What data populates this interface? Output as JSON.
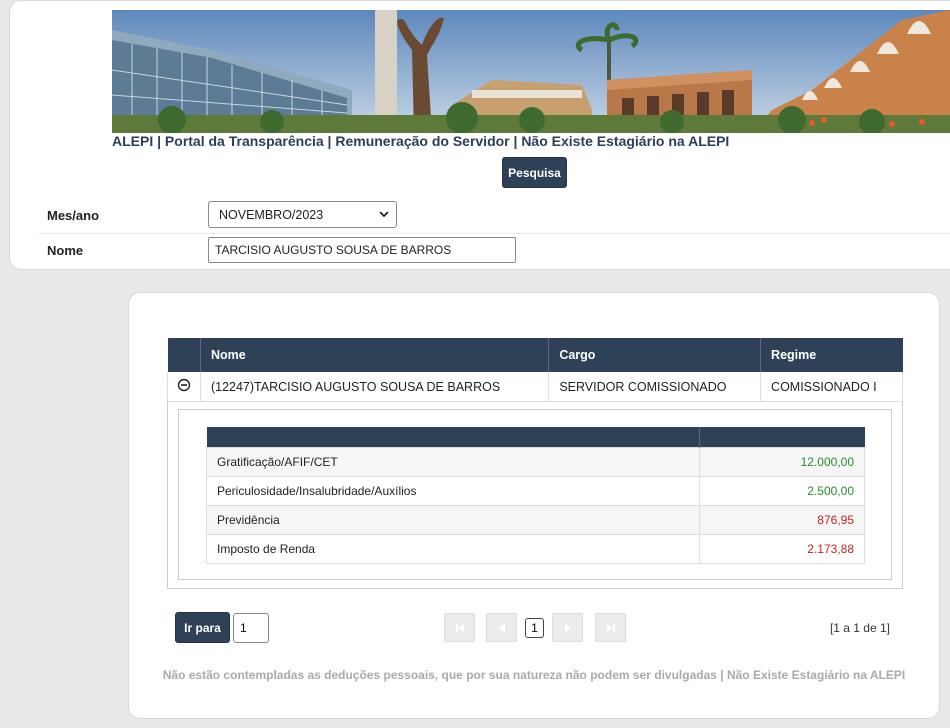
{
  "header": {
    "title": "ALEPI | Portal da Transparência | Remuneração do Servidor | Não Existe Estagiário na ALEPI",
    "search_label": "Pesquisa"
  },
  "form": {
    "month_label": "Mes/ano",
    "month_value": "NOVEMBRO/2023",
    "name_label": "Nome",
    "name_value": "TARCISIO AUGUSTO SOUSA DE BARROS"
  },
  "table": {
    "columns": [
      "Nome",
      "Cargo",
      "Regime"
    ],
    "row": {
      "nome": "(12247)TARCISIO AUGUSTO SOUSA DE BARROS",
      "cargo": "SERVIDOR COMISSIONADO",
      "regime": "COMISSIONADO I"
    }
  },
  "details": [
    {
      "label": "Gratificação/AFIF/CET",
      "value": "12.000,00",
      "kind": "credit"
    },
    {
      "label": "Periculosidade/Insalubridade/Auxílios",
      "value": "2.500,00",
      "kind": "credit"
    },
    {
      "label": "Previdência",
      "value": "876,95",
      "kind": "debit"
    },
    {
      "label": "Imposto de Renda",
      "value": "2.173,88",
      "kind": "debit"
    }
  ],
  "pagination": {
    "go_label": "Ir para",
    "go_value": "1",
    "current_page": "1",
    "info": "[1 a 1 de 1]"
  },
  "footer": {
    "note": "Não estão contempladas as deduções pessoais, que por sua natureza não podem ser divulgadas | Não Existe Estagiário na ALEPI"
  },
  "colors": {
    "header_bg": "#2f4156",
    "credit": "#2a8a2a",
    "debit": "#c02626"
  }
}
